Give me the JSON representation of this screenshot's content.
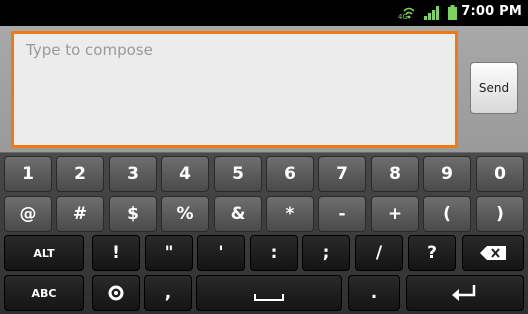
{
  "status_bar": {
    "time": "7:00 PM",
    "icons": [
      "data-wifi-icon",
      "signal-icon",
      "battery-icon"
    ]
  },
  "compose": {
    "placeholder": "Type to compose",
    "send_label": "Send",
    "accent_color": "#f07a12"
  },
  "keyboard": {
    "rows": [
      [
        "1",
        "2",
        "3",
        "4",
        "5",
        "6",
        "7",
        "8",
        "9",
        "0"
      ],
      [
        "@",
        "#",
        "$",
        "%",
        "&",
        "*",
        "-",
        "+",
        "(",
        ")"
      ],
      [
        "ALT",
        "!",
        "\"",
        "'",
        ":",
        ";",
        "/",
        "?",
        "backspace"
      ],
      [
        "ABC",
        "settings",
        ",",
        "space",
        ".",
        "enter"
      ]
    ]
  }
}
